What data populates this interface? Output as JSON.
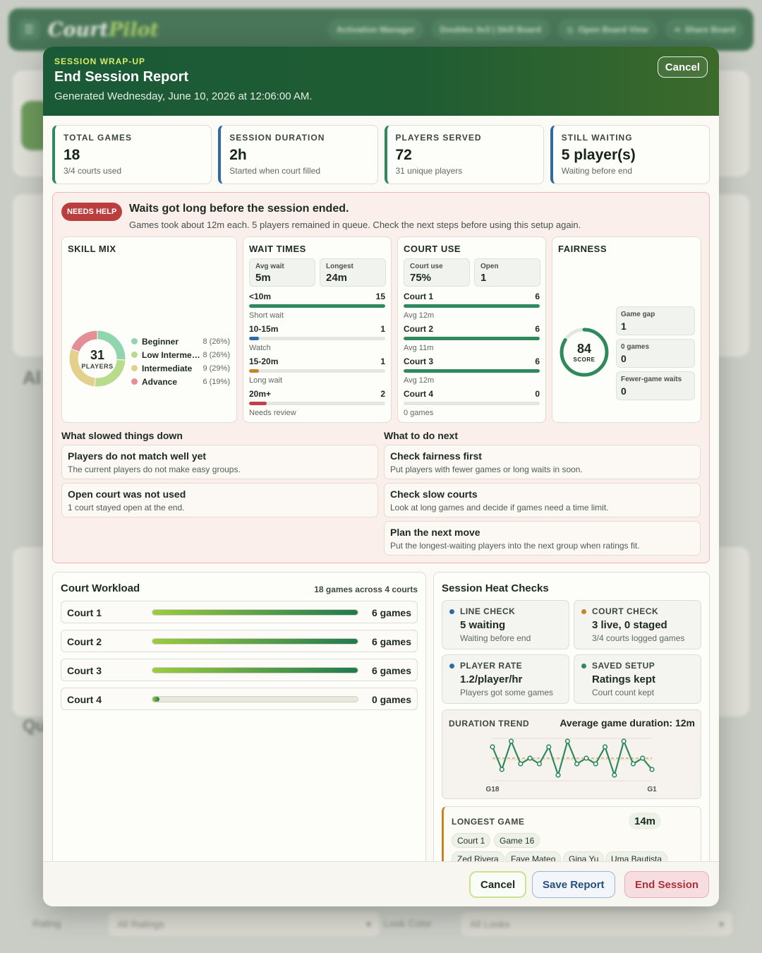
{
  "bg": {
    "logo_a": "Court",
    "logo_b": "Pilot",
    "nav": [
      "Activation Manager",
      "Doubles 3v3 | Skill Board",
      "Open Board View",
      "Share Board"
    ],
    "filter_rating_label": "Rating",
    "filter_rating_value": "All Ratings",
    "filter_look_label": "Look Color",
    "filter_look_value": "All Looks",
    "frag_al": "Al",
    "frag_qu": "Qu"
  },
  "modal": {
    "eyebrow": "SESSION WRAP-UP",
    "title": "End Session Report",
    "generated": "Generated Wednesday, June 10, 2026 at 12:06:00 AM.",
    "header_cancel": "Cancel"
  },
  "stats": [
    {
      "label": "TOTAL GAMES",
      "value": "18",
      "note": "3/4 courts used"
    },
    {
      "label": "SESSION DURATION",
      "value": "2h",
      "note": "Started when court filled"
    },
    {
      "label": "PLAYERS SERVED",
      "value": "72",
      "note": "31 unique players"
    },
    {
      "label": "STILL WAITING",
      "value": "5 player(s)",
      "note": "Waiting before end"
    }
  ],
  "help": {
    "badge": "NEEDS HELP",
    "title": "Waits got long before the session ended.",
    "subtitle": "Games took about 12m each. 5 players remained in queue. Check the next steps before using this setup again."
  },
  "skill_mix": {
    "title": "SKILL MIX",
    "total": "31",
    "total_label": "PLAYERS",
    "items": [
      {
        "name": "Beginner",
        "value": "8 (26%)",
        "count": 8,
        "color": "#8fd5ae"
      },
      {
        "name": "Low Intermediate",
        "value": "8 (26%)",
        "count": 8,
        "color": "#b9dc8c"
      },
      {
        "name": "Intermediate",
        "value": "9 (29%)",
        "count": 9,
        "color": "#e3d08c"
      },
      {
        "name": "Advance",
        "value": "6 (19%)",
        "count": 6,
        "color": "#e48e96"
      }
    ]
  },
  "wait_times": {
    "title": "WAIT TIMES",
    "avg_label": "Avg wait",
    "avg_value": "5m",
    "longest_label": "Longest",
    "longest_value": "24m",
    "rows": [
      {
        "label": "<10m",
        "count": "15",
        "note": "Short wait",
        "fraction": 1.0,
        "color": "#2e8a5c"
      },
      {
        "label": "10-15m",
        "count": "1",
        "note": "Watch",
        "fraction": 0.07,
        "color": "#2f6aa0"
      },
      {
        "label": "15-20m",
        "count": "1",
        "note": "Long wait",
        "fraction": 0.07,
        "color": "#c5862a"
      },
      {
        "label": "20m+",
        "count": "2",
        "note": "Needs review",
        "fraction": 0.13,
        "color": "#c0424a"
      }
    ]
  },
  "court_use": {
    "title": "COURT USE",
    "use_label": "Court use",
    "use_value": "75%",
    "open_label": "Open",
    "open_value": "1",
    "rows": [
      {
        "label": "Court 1",
        "count": "6",
        "note": "Avg 12m",
        "fraction": 1.0
      },
      {
        "label": "Court 2",
        "count": "6",
        "note": "Avg 11m",
        "fraction": 1.0
      },
      {
        "label": "Court 3",
        "count": "6",
        "note": "Avg 12m",
        "fraction": 1.0
      },
      {
        "label": "Court 4",
        "count": "0",
        "note": "0 games",
        "fraction": 0
      }
    ]
  },
  "fairness": {
    "title": "FAIRNESS",
    "score": "84",
    "score_label": "SCORE",
    "score_fraction": 0.84,
    "cards": [
      {
        "label": "Game gap",
        "value": "1"
      },
      {
        "label": "0 games",
        "value": "0"
      },
      {
        "label": "Fewer-game waits",
        "value": "0"
      }
    ]
  },
  "slowed": {
    "heading": "What slowed things down",
    "items": [
      {
        "title": "Players do not match well yet",
        "text": "The current players do not make easy groups."
      },
      {
        "title": "Open court was not used",
        "text": "1 court stayed open at the end."
      }
    ]
  },
  "next": {
    "heading": "What to do next",
    "items": [
      {
        "title": "Check fairness first",
        "text": "Put players with fewer games or long waits in soon."
      },
      {
        "title": "Check slow courts",
        "text": "Look at long games and decide if games need a time limit."
      },
      {
        "title": "Plan the next move",
        "text": "Put the longest-waiting players into the next group when ratings fit."
      }
    ]
  },
  "workload": {
    "title": "Court Workload",
    "meta": "18 games across 4 courts",
    "courts": [
      {
        "name": "Court 1",
        "count": "6 games",
        "fraction": 1.0
      },
      {
        "name": "Court 2",
        "count": "6 games",
        "fraction": 1.0
      },
      {
        "name": "Court 3",
        "count": "6 games",
        "fraction": 1.0
      },
      {
        "name": "Court 4",
        "count": "0 games",
        "fraction": 0
      }
    ]
  },
  "heat": {
    "title": "Session Heat Checks",
    "cards": [
      {
        "label": "LINE CHECK",
        "value": "5 waiting",
        "note": "Waiting before end",
        "color": "#2f6aa0"
      },
      {
        "label": "COURT CHECK",
        "value": "3 live, 0 staged",
        "note": "3/4 courts logged games",
        "color": "#c5862a"
      },
      {
        "label": "PLAYER RATE",
        "value": "1.2/player/hr",
        "note": "Players got some games",
        "color": "#2f6aa0"
      },
      {
        "label": "SAVED SETUP",
        "value": "Ratings kept",
        "note": "Court count kept",
        "color": "#2e8a5c"
      }
    ]
  },
  "chart_data": {
    "type": "line",
    "title": "DURATION TREND",
    "subtitle": "Average game duration: 12m",
    "x_start_label": "G18",
    "x_end_label": "G1",
    "average": 12,
    "ylim": [
      8,
      15.5
    ],
    "series": [
      {
        "values": [
          14,
          10,
          15,
          11,
          12,
          11,
          14,
          9,
          15,
          11,
          12,
          11,
          14,
          9,
          15,
          11,
          12,
          10
        ]
      }
    ],
    "grid": true,
    "color": "#2e8a5c",
    "avg_color": "#c5862a"
  },
  "longest": {
    "label": "LONGEST GAME",
    "time": "14m",
    "chips": [
      "Court 1",
      "Game 16"
    ],
    "players": [
      "Zed Rivera",
      "Faye Mateo",
      "Gina Yu",
      "Uma Bautista"
    ]
  },
  "footer": {
    "cancel": "Cancel",
    "save": "Save Report",
    "end": "End Session"
  }
}
